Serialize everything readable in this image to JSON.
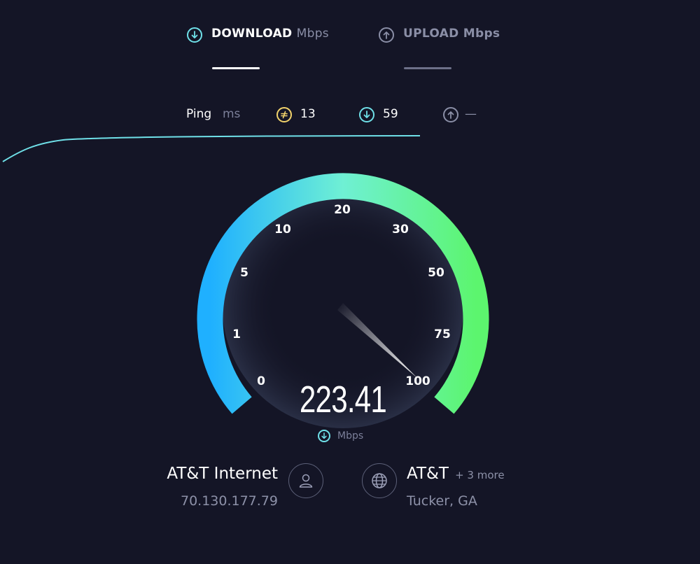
{
  "tabs": {
    "download": {
      "label": "DOWNLOAD",
      "unit": "Mbps",
      "active": true
    },
    "upload": {
      "label": "UPLOAD",
      "unit": "Mbps",
      "active": false
    }
  },
  "ping": {
    "label": "Ping",
    "unit": "ms",
    "idle_value": "13",
    "download_value": "59",
    "upload_value": "—"
  },
  "gauge": {
    "scale_labels": [
      "0",
      "1",
      "5",
      "10",
      "20",
      "30",
      "50",
      "75",
      "100"
    ],
    "needle_level": 1.0
  },
  "result": {
    "value": "223.41",
    "unit": "Mbps"
  },
  "provider": {
    "name": "AT&T Internet",
    "ip": "70.130.177.79"
  },
  "server": {
    "name": "AT&T",
    "more": "+ 3 more",
    "location": "Tucker, GA"
  },
  "colors": {
    "background": "#141526",
    "download_accent": "#6fe0e8",
    "ping_idle_accent": "#f2d36b",
    "gauge_start": "#1fb0ff",
    "gauge_end": "#5cf56e"
  },
  "icons": {
    "download": "arrow-down-circle-icon",
    "upload": "arrow-up-circle-icon",
    "ping_idle": "jitter-circle-icon",
    "provider": "user-icon",
    "server": "globe-icon"
  }
}
